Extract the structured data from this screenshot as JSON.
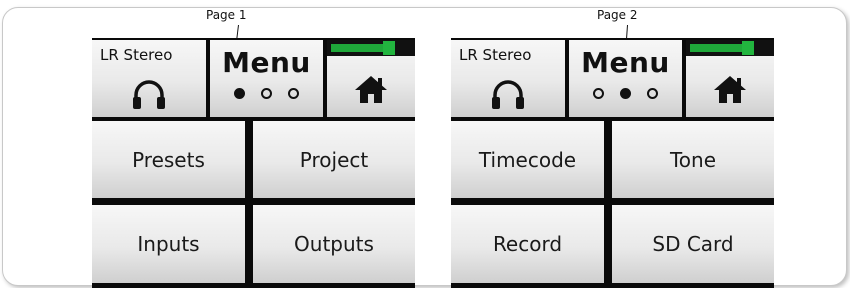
{
  "callouts": [
    {
      "label": "Page 1"
    },
    {
      "label": "Page 2"
    }
  ],
  "panels": [
    {
      "source_label": "LR Stereo",
      "menu_title": "Menu",
      "page_dots": [
        true,
        false,
        false
      ],
      "meter_level": 0.8,
      "buttons": [
        "Presets",
        "Project",
        "Inputs",
        "Outputs"
      ]
    },
    {
      "source_label": "LR Stereo",
      "menu_title": "Menu",
      "page_dots": [
        false,
        true,
        false
      ],
      "meter_level": 0.8,
      "buttons": [
        "Timecode",
        "Tone",
        "Record",
        "SD Card"
      ]
    }
  ],
  "icons": {
    "source": "headphones-icon",
    "home": "home-icon",
    "meter": "level-meter"
  },
  "colors": {
    "meter_green": "#1fa83a",
    "button_text": "#1a1a1a",
    "panel_background": "#0a0a0a"
  }
}
